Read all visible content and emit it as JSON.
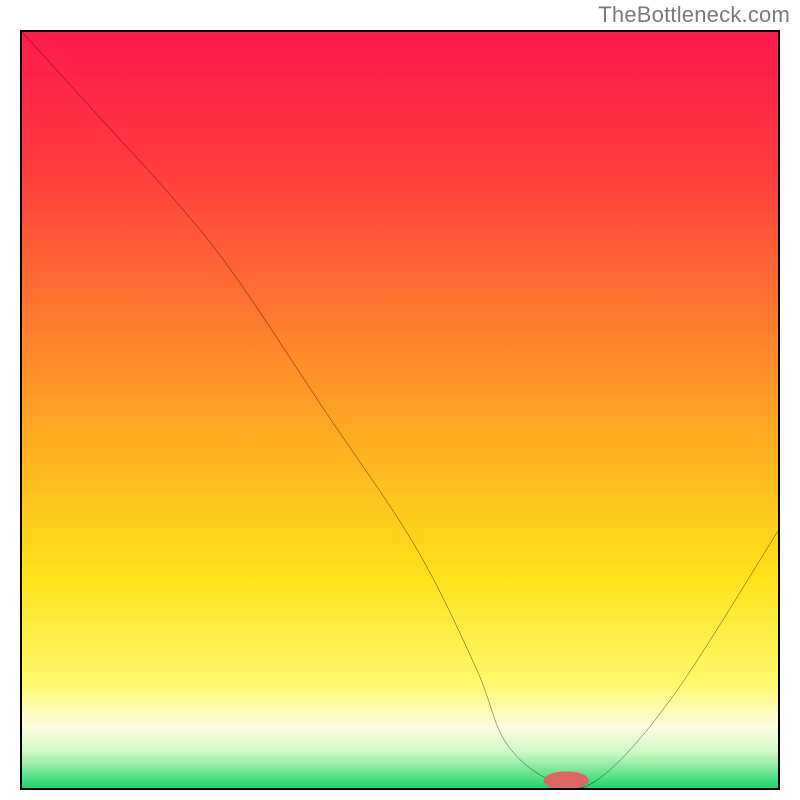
{
  "watermark": "TheBottleneck.com",
  "chart_data": {
    "type": "line",
    "title": "",
    "xlabel": "",
    "ylabel": "",
    "xlim": [
      0,
      100
    ],
    "ylim": [
      0,
      100
    ],
    "x": [
      0,
      10,
      20,
      28,
      40,
      52,
      60,
      64,
      70,
      76,
      86,
      100
    ],
    "values": [
      100,
      89,
      78,
      68,
      50,
      32,
      16,
      6,
      1,
      1,
      12,
      34
    ],
    "marker": {
      "x": 72,
      "y": 1,
      "rx": 3.0,
      "ry": 1.2,
      "color": "#e06666"
    },
    "gradient_stops": [
      {
        "offset": 0.0,
        "color": "#ff1a4b"
      },
      {
        "offset": 0.18,
        "color": "#ff3b3e"
      },
      {
        "offset": 0.38,
        "color": "#ff7a2f"
      },
      {
        "offset": 0.55,
        "color": "#ffb020"
      },
      {
        "offset": 0.72,
        "color": "#ffe21a"
      },
      {
        "offset": 0.86,
        "color": "#fff86a"
      },
      {
        "offset": 0.92,
        "color": "#fdfde0"
      },
      {
        "offset": 0.955,
        "color": "#c9f7c0"
      },
      {
        "offset": 0.975,
        "color": "#7de89a"
      },
      {
        "offset": 1.0,
        "color": "#1fd46a"
      }
    ]
  }
}
